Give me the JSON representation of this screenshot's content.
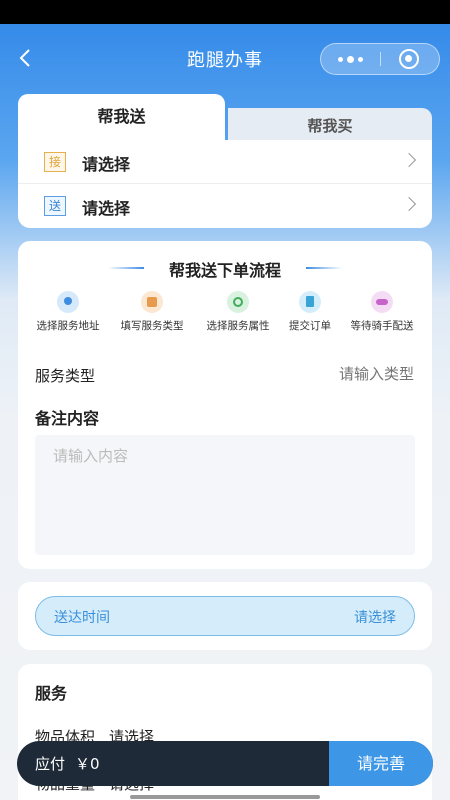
{
  "nav": {
    "title": "跑腿办事"
  },
  "tabs": [
    {
      "label": "帮我送"
    },
    {
      "label": "帮我买"
    }
  ],
  "address": {
    "pickup": {
      "tag": "接",
      "value": "请选择"
    },
    "delivery": {
      "tag": "送",
      "value": "请选择"
    }
  },
  "flow": {
    "title": "帮我送下单流程",
    "steps": [
      {
        "label": "选择服务地址",
        "icon": "location-icon"
      },
      {
        "label": "填写服务类型",
        "icon": "edit-icon"
      },
      {
        "label": "选择服务属性",
        "icon": "target-icon"
      },
      {
        "label": "提交订单",
        "icon": "document-icon"
      },
      {
        "label": "等待骑手配送",
        "icon": "scooter-icon"
      }
    ]
  },
  "service_type": {
    "label": "服务类型",
    "placeholder": "请输入类型"
  },
  "remark": {
    "title": "备注内容",
    "placeholder": "请输入内容"
  },
  "delivery_time": {
    "label": "送达时间",
    "value": "请选择"
  },
  "service": {
    "title": "服务",
    "volume": {
      "label": "物品体积",
      "value": "请选择"
    },
    "weight": {
      "label": "物品重量",
      "value": "请选择"
    }
  },
  "bottom": {
    "pay_label": "应付",
    "amount": "￥0",
    "submit": "请完善"
  },
  "colors": {
    "primary": "#3e97e6",
    "dark_bar": "#1e2a38",
    "accent_text": "#3a90d8"
  }
}
